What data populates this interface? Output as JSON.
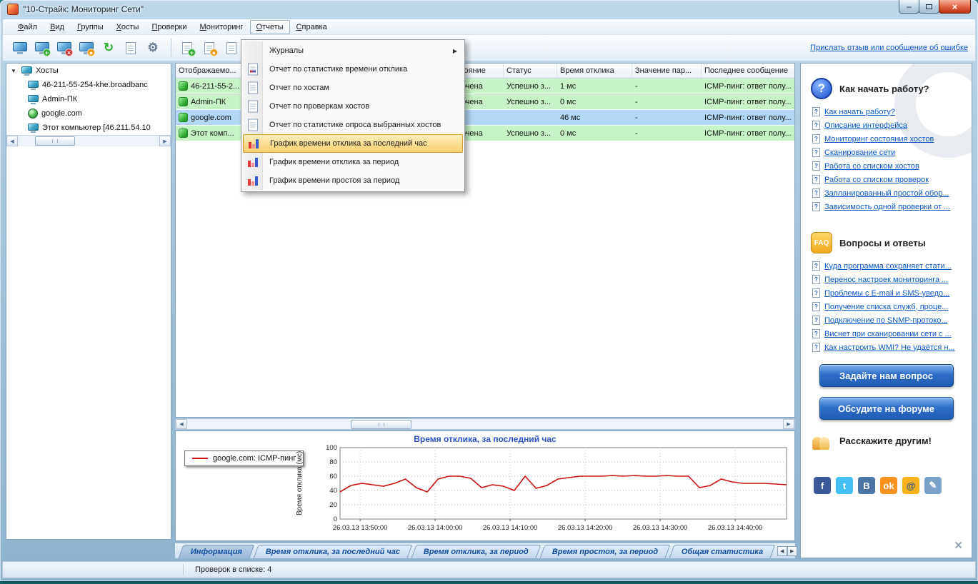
{
  "window": {
    "title": "\"10-Страйк: Мониторинг Сети\""
  },
  "menubar": {
    "items": [
      "Файл",
      "Вид",
      "Группы",
      "Хосты",
      "Проверки",
      "Мониторинг",
      "Отчеты",
      "Справка"
    ],
    "open_menu": "Отчеты"
  },
  "toolbar": {
    "feedback_link": "Прислать отзыв или сообщение об ошибке",
    "groups": [
      [
        {
          "name": "network-scan-icon",
          "kind": "monitor"
        },
        {
          "name": "add-host-icon",
          "kind": "monitor",
          "badge": "+",
          "badge_color": "#2fae2f"
        },
        {
          "name": "delete-host-icon",
          "kind": "monitor",
          "badge": "×",
          "badge_color": "#d03030"
        },
        {
          "name": "host-properties-icon",
          "kind": "monitor",
          "badge": "●",
          "badge_color": "#e8980a"
        },
        {
          "name": "refresh-icon",
          "kind": "glyph",
          "glyph": "↻",
          "color": "#2fae2f"
        },
        {
          "name": "host-list-icon",
          "kind": "doc"
        },
        {
          "name": "settings-icon",
          "kind": "glyph",
          "glyph": "⚙",
          "color": "#6b7f92"
        }
      ],
      [
        {
          "name": "add-check-icon",
          "kind": "doc",
          "badge": "+",
          "badge_color": "#2fae2f"
        },
        {
          "name": "edit-check-icon",
          "kind": "doc",
          "badge": "●",
          "badge_color": "#e8980a"
        },
        {
          "name": "journal-icon",
          "kind": "doc"
        }
      ]
    ]
  },
  "tree": {
    "root": {
      "label": "Хосты"
    },
    "items": [
      {
        "label": "46-211-55-254-khe.broadbanc",
        "icon": "computer-icon"
      },
      {
        "label": "Admin-ПК",
        "icon": "computer-icon"
      },
      {
        "label": "google.com",
        "icon": "globe-icon"
      },
      {
        "label": "Этот компьютер [46.211.54.10",
        "icon": "computer-icon"
      }
    ]
  },
  "reports_menu": {
    "items": [
      {
        "label": "Журналы",
        "icon": "",
        "submenu": true,
        "highlighted": false
      },
      {
        "label": "Отчет по статистике времени отклика",
        "icon": "report-chart-icon",
        "submenu": false,
        "highlighted": false
      },
      {
        "label": "Отчет по хостам",
        "icon": "report-icon",
        "submenu": false,
        "highlighted": false
      },
      {
        "label": "Отчет по проверкам хостов",
        "icon": "report-icon",
        "submenu": false,
        "highlighted": false
      },
      {
        "label": "Отчет по статистике опроса выбранных хостов",
        "icon": "report-icon",
        "submenu": false,
        "highlighted": false
      },
      {
        "label": "График времени отклика за последний час",
        "icon": "chart-icon",
        "submenu": false,
        "highlighted": true
      },
      {
        "label": "График времени отклика за период",
        "icon": "chart-icon",
        "submenu": false,
        "highlighted": false
      },
      {
        "label": "График времени простоя за период",
        "icon": "chart-icon",
        "submenu": false,
        "highlighted": false
      }
    ]
  },
  "table": {
    "columns": [
      {
        "label": "Отображаемо..."
      },
      {
        "label": ""
      },
      {
        "label": "Состояние"
      },
      {
        "label": "Статус"
      },
      {
        "label": "Время отклика"
      },
      {
        "label": "Значение пар..."
      },
      {
        "label": "Последнее сообщение"
      }
    ],
    "rows": [
      {
        "name": "46-211-55-2...",
        "state": "Включена",
        "status": "Успешно з...",
        "response_time": "1 мс",
        "param_value": "-",
        "last_message": "ICMP-пинг: ответ полу...",
        "selected": false
      },
      {
        "name": "Admin-ПК",
        "state": "Включена",
        "status": "Успешно з...",
        "response_time": "0 мс",
        "param_value": "-",
        "last_message": "ICMP-пинг: ответ полу...",
        "selected": false
      },
      {
        "name": "google.com",
        "state": "",
        "status": "",
        "response_time": "46 мс",
        "param_value": "-",
        "last_message": "ICMP-пинг: ответ полу...",
        "selected": true
      },
      {
        "name": "Этот комп...",
        "state": "Включена",
        "status": "Успешно з...",
        "response_time": "0 мс",
        "param_value": "-",
        "last_message": "ICMP-пинг: ответ полу...",
        "selected": false
      }
    ]
  },
  "chart_data": {
    "type": "line",
    "title": "Время отклика, за последний час",
    "ylabel": "Время отклика (мс)",
    "ylim": [
      0,
      100
    ],
    "yticks": [
      0,
      20,
      40,
      60,
      80,
      100
    ],
    "grid": true,
    "legend_position": "top-left",
    "x_tick_labels": [
      "26.03.13 13:50:00",
      "26.03.13 14:00:00",
      "26.03.13 14:10:00",
      "26.03.13 14:20:00",
      "26.03.13 14:30:00",
      "26.03.13 14:40:00"
    ],
    "series": [
      {
        "name": "google.com: ICMP-пинг",
        "color": "#cc1111",
        "values": [
          38,
          47,
          50,
          48,
          46,
          50,
          56,
          44,
          38,
          56,
          60,
          60,
          57,
          44,
          48,
          46,
          40,
          60,
          43,
          47,
          56,
          58,
          60,
          60,
          60,
          61,
          60,
          61,
          60,
          60,
          61,
          60,
          60,
          44,
          47,
          56,
          52,
          50,
          50,
          50,
          49,
          48
        ]
      }
    ]
  },
  "tabs": {
    "items": [
      "Информация",
      "Время отклика, за последний час",
      "Время отклика, за период",
      "Время простоя, за период",
      "Общая статистика"
    ],
    "active_index": 0
  },
  "statusbar": {
    "text": "Проверок в списке: 4"
  },
  "help": {
    "getting_started": {
      "title": "Как начать работу?",
      "links": [
        "Как начать работу?",
        "Описание интерфейса",
        "Мониторинг состояния хостов",
        "Сканирование сети",
        "Работа со списком хостов",
        "Работа со списком проверок",
        "Запланированный простой обор...",
        "Зависимость одной проверки от ..."
      ]
    },
    "faq": {
      "title": "Вопросы и ответы",
      "links": [
        "Куда программа сохраняет стати...",
        "Перенос настроек мониторинга ...",
        "Проблемы с E-mail и SMS-уведо...",
        "Получение списка служб, проце...",
        "Подключение по SNMP-протоко...",
        "Виснет при сканировании сети с ...",
        "Как настроить WMI? Не удаётся н..."
      ]
    },
    "ask_button": "Задайте нам вопрос",
    "forum_button": "Обсудите на форуме",
    "share_title": "Расскажите другим!",
    "social": [
      {
        "name": "facebook",
        "glyph": "f",
        "color": "#3b5998",
        "text_color": "#ffffff"
      },
      {
        "name": "twitter",
        "glyph": "t",
        "color": "#45c0f5",
        "text_color": "#ffffff"
      },
      {
        "name": "vk",
        "glyph": "В",
        "color": "#4a76a8",
        "text_color": "#ffffff"
      },
      {
        "name": "odnoklassniki",
        "glyph": "ok",
        "color": "#f7931e",
        "text_color": "#ffffff"
      },
      {
        "name": "mail-ru",
        "glyph": "@",
        "color": "#f9b21d",
        "text_color": "#23518e"
      },
      {
        "name": "livejournal",
        "glyph": "✎",
        "color": "#7ba0c9",
        "text_color": "#ffffff"
      }
    ]
  }
}
